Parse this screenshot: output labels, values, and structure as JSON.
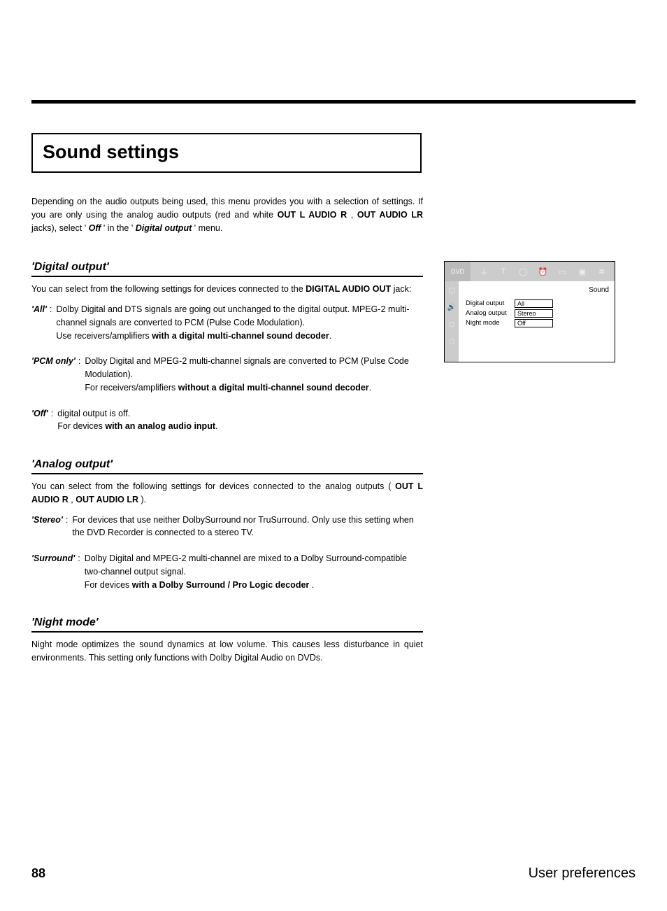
{
  "page_title": "Sound settings",
  "intro": {
    "line1_pre": "Depending on the audio outputs being used, this menu provides you with a selection of settings. If you are only using the analog audio outputs (red and white ",
    "bold1": "OUT L AUDIO R",
    "mid1": " , ",
    "bold2": "OUT AUDIO LR",
    "mid2": " jacks), select '",
    "italic1": "Off",
    "mid3": "' in the '",
    "italic2": "Digital output",
    "end": "' menu."
  },
  "sections": {
    "digital": {
      "heading": "'Digital output'",
      "intro_pre": "You can select from the following settings for devices connected to the ",
      "intro_bold": "DIGITAL AUDIO OUT",
      "intro_post": " jack:",
      "items": [
        {
          "term": "'All'",
          "l1": "Dolby Digital and DTS signals are going out unchanged to the digital output. MPEG-2 multi-channel signals are converted to PCM (Pulse Code Modulation).",
          "l2_pre": "Use receivers/amplifiers ",
          "l2_bold": "with a digital multi-channel sound decoder",
          "l2_post": "."
        },
        {
          "term": "'PCM only'",
          "l1": "Dolby Digital and MPEG-2 multi-channel signals are converted to PCM (Pulse Code Modulation).",
          "l2_pre": "For receivers/amplifiers ",
          "l2_bold": "without a digital multi-channel sound decoder",
          "l2_post": "."
        },
        {
          "term": "'Off'",
          "l1": "digital output is off.",
          "l2_pre": "For devices ",
          "l2_bold": "with an analog audio input",
          "l2_post": "."
        }
      ]
    },
    "analog": {
      "heading": "'Analog output'",
      "intro_pre": "You can select from the following settings for devices connected to the analog outputs ( ",
      "intro_bold1": "OUT L AUDIO R",
      "intro_mid": " , ",
      "intro_bold2": "OUT AUDIO LR",
      "intro_post": " ).",
      "items": [
        {
          "term": "'Stereo'",
          "l1": "For devices that use neither DolbySurround nor TruSurround. Only use this setting when the DVD Recorder is connected to a stereo TV."
        },
        {
          "term": "'Surround'",
          "l1": "Dolby Digital and MPEG-2 multi-channel are mixed to a Dolby Surround-compatible two-channel output signal.",
          "l2_pre": "For devices ",
          "l2_bold": "with a Dolby Surround / Pro Logic decoder",
          "l2_post": " ."
        }
      ]
    },
    "night": {
      "heading": "'Night mode'",
      "body": "Night mode optimizes the sound dynamics at low volume. This causes less disturbance in quiet environments. This setting only functions with Dolby Digital Audio on DVDs."
    }
  },
  "osd": {
    "dvd_label": "DVD",
    "title": "Sound",
    "rows": [
      {
        "label": "Digital output",
        "value": "All"
      },
      {
        "label": "Analog output",
        "value": "Stereo"
      },
      {
        "label": "Night mode",
        "value": "Off"
      }
    ]
  },
  "footer": {
    "page": "88",
    "section": "User preferences"
  }
}
